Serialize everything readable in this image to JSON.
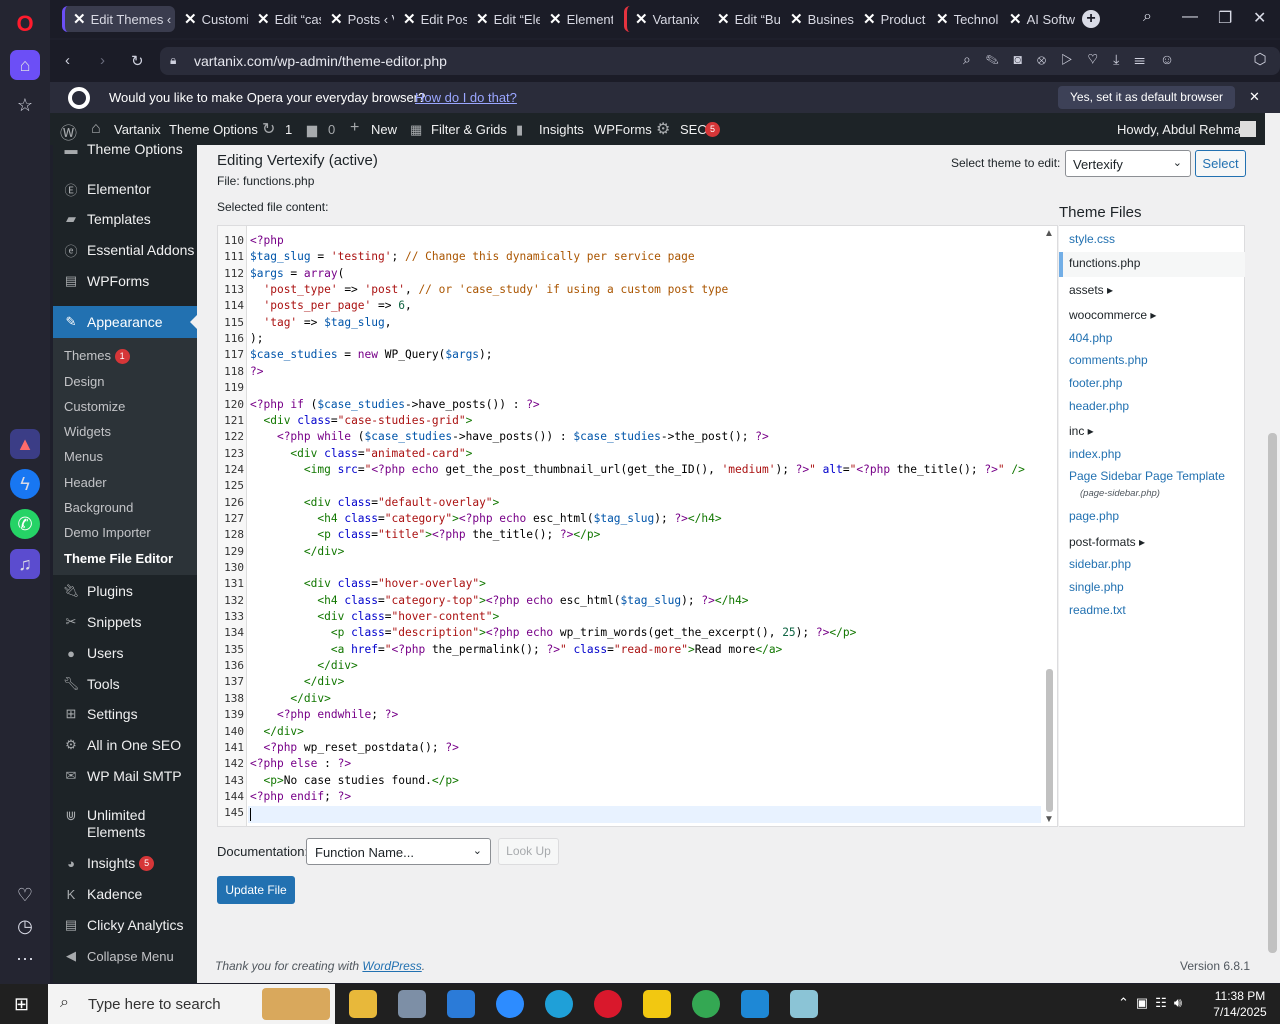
{
  "browser": {
    "tabs": [
      {
        "label": "Edit Themes ‹"
      },
      {
        "label": "Customi"
      },
      {
        "label": "Edit “cas"
      },
      {
        "label": "Posts ‹ V"
      },
      {
        "label": "Edit Pos"
      },
      {
        "label": "Edit “Ele"
      },
      {
        "label": "Element"
      },
      {
        "label": "Vartanix"
      },
      {
        "label": "Edit “Bu"
      },
      {
        "label": "Business"
      },
      {
        "label": "Product"
      },
      {
        "label": "Technol"
      },
      {
        "label": "AI Softw"
      }
    ],
    "url": "vartanix.com/wp-admin/theme-editor.php",
    "infobar": {
      "message": "Would you like to make Opera your everyday browser?",
      "link": "How do I do that?",
      "button": "Yes, set it as default browser"
    }
  },
  "adminbar": {
    "site": "Vartanix",
    "theme_options": "Theme Options",
    "updates": "1",
    "comments": "0",
    "new": "New",
    "filter": "Filter & Grids",
    "insights": "Insights",
    "wpforms": "WPForms",
    "seo": "SEO",
    "seo_badge": "5",
    "howdy": "Howdy, Abdul Rehman"
  },
  "menu": {
    "top_partial": "Theme Options",
    "items": [
      {
        "label": "Elementor"
      },
      {
        "label": "Templates"
      },
      {
        "label": "Essential Addons"
      },
      {
        "label": "WPForms"
      }
    ],
    "appearance": "Appearance",
    "sub": [
      {
        "label": "Themes"
      },
      {
        "label": "Design"
      },
      {
        "label": "Customize"
      },
      {
        "label": "Widgets"
      },
      {
        "label": "Menus"
      },
      {
        "label": "Header"
      },
      {
        "label": "Background"
      },
      {
        "label": "Demo Importer"
      },
      {
        "label": "Theme File Editor"
      }
    ],
    "themes_badge": "1",
    "items2": [
      {
        "label": "Plugins"
      },
      {
        "label": "Snippets"
      },
      {
        "label": "Users"
      },
      {
        "label": "Tools"
      },
      {
        "label": "Settings"
      },
      {
        "label": "All in One SEO"
      },
      {
        "label": "WP Mail SMTP"
      }
    ],
    "unlimited1": "Unlimited",
    "unlimited2": "Elements",
    "insights": "Insights",
    "insights_badge": "5",
    "kadence": "Kadence",
    "clicky": "Clicky Analytics",
    "collapse": "Collapse Menu"
  },
  "editor": {
    "heading": "Editing Vertexify (active)",
    "file_label": "File: functions.php",
    "select_theme_label": "Select theme to edit:",
    "theme_value": "Vertexify",
    "select_button": "Select",
    "selected_content": "Selected file content:",
    "theme_files_title": "Theme Files",
    "documentation": "Documentation:",
    "function_placeholder": "Function Name...",
    "lookup": "Look Up",
    "update": "Update File",
    "footer_thanks": "Thank you for creating with ",
    "footer_wp": "WordPress",
    "footer_dot": ".",
    "version": "Version 6.8.1",
    "code": [
      {
        "n": "110"
      },
      {
        "n": "111"
      },
      {
        "n": "112"
      },
      {
        "n": "113"
      },
      {
        "n": "114"
      },
      {
        "n": "115"
      },
      {
        "n": "116"
      },
      {
        "n": "117"
      },
      {
        "n": "118"
      },
      {
        "n": "119"
      },
      {
        "n": "120"
      },
      {
        "n": "121"
      },
      {
        "n": "122"
      },
      {
        "n": "123"
      },
      {
        "n": "124"
      },
      {
        "n": "125"
      },
      {
        "n": "126"
      },
      {
        "n": "127"
      },
      {
        "n": "128"
      },
      {
        "n": "129"
      },
      {
        "n": "130"
      },
      {
        "n": "131"
      },
      {
        "n": "132"
      },
      {
        "n": "133"
      },
      {
        "n": "134"
      },
      {
        "n": "135"
      },
      {
        "n": "136"
      },
      {
        "n": "137"
      },
      {
        "n": "138"
      },
      {
        "n": "139"
      },
      {
        "n": "140"
      },
      {
        "n": "141"
      },
      {
        "n": "142"
      },
      {
        "n": "143"
      },
      {
        "n": "144"
      },
      {
        "n": "145"
      }
    ]
  },
  "files": [
    {
      "name": "style.css",
      "type": "file"
    },
    {
      "name": "functions.php",
      "type": "file"
    },
    {
      "name": "assets",
      "type": "dir"
    },
    {
      "name": "woocommerce",
      "type": "dir"
    },
    {
      "name": "404.php",
      "type": "file"
    },
    {
      "name": "comments.php",
      "type": "file"
    },
    {
      "name": "footer.php",
      "type": "file"
    },
    {
      "name": "header.php",
      "type": "file"
    },
    {
      "name": "inc",
      "type": "dir"
    },
    {
      "name": "index.php",
      "type": "file"
    },
    {
      "name": "Page Sidebar Page Template",
      "type": "file"
    },
    {
      "name": "(page-sidebar.php)",
      "type": "note"
    },
    {
      "name": "page.php",
      "type": "file"
    },
    {
      "name": "post-formats",
      "type": "dir"
    },
    {
      "name": "sidebar.php",
      "type": "file"
    },
    {
      "name": "single.php",
      "type": "file"
    },
    {
      "name": "readme.txt",
      "type": "file"
    }
  ],
  "taskbar": {
    "search": "Type here to search",
    "time": "11:38 PM",
    "date": "7/14/2025"
  },
  "colors": {
    "wp_blue": "#2271b1",
    "admin_bg": "#1d2327",
    "opera_red": "#ff1b2d"
  }
}
